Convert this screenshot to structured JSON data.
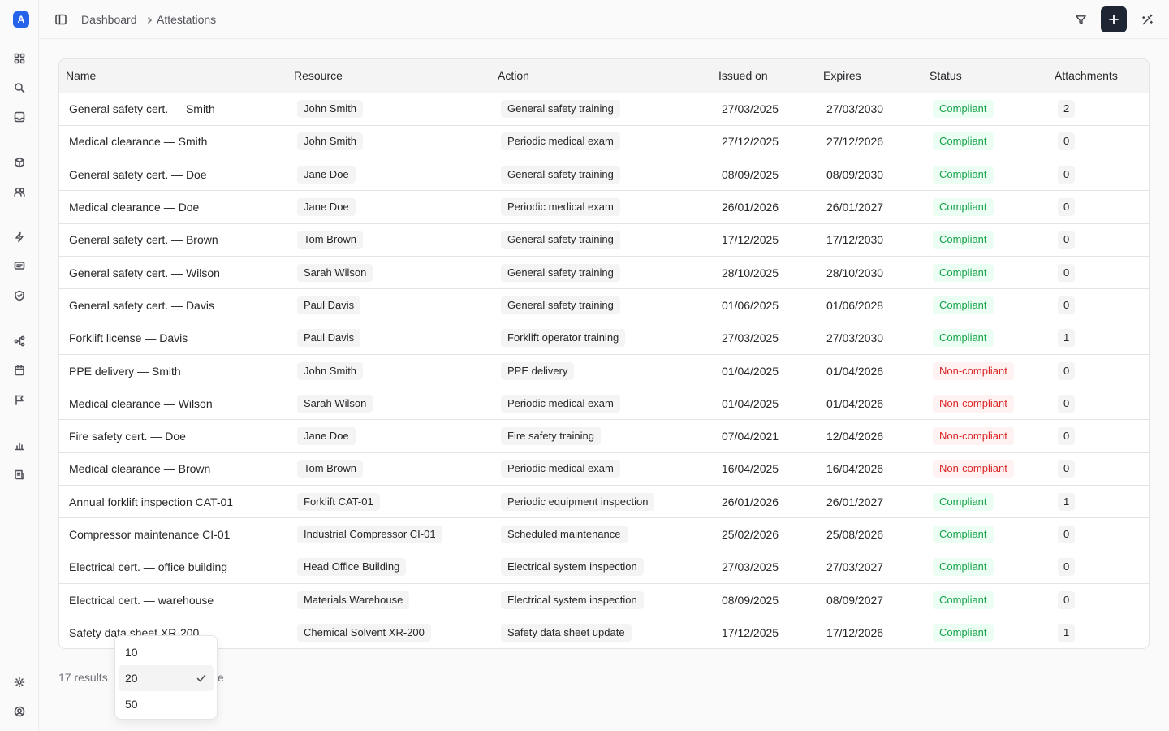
{
  "app": {
    "logo_letter": "A"
  },
  "sidebar": {
    "icons": [
      "grid-icon",
      "search-icon",
      "inbox-icon",
      "box-icon",
      "users-icon",
      "bolt-icon",
      "chat-icon",
      "shield-icon",
      "workflow-icon",
      "calendar-icon",
      "flag-icon",
      "chart-icon",
      "report-icon",
      "settings-icon",
      "account-icon"
    ]
  },
  "breadcrumb": {
    "home": "Dashboard",
    "current": "Attestations"
  },
  "table": {
    "columns": [
      "Name",
      "Resource",
      "Action",
      "Issued on",
      "Expires",
      "Status",
      "Attachments"
    ],
    "rows": [
      {
        "name": "General safety cert. — Smith",
        "resource": "John Smith",
        "action": "General safety training",
        "issued": "27/03/2025",
        "expires": "27/03/2030",
        "status": "Compliant",
        "attachments": "2"
      },
      {
        "name": "Medical clearance — Smith",
        "resource": "John Smith",
        "action": "Periodic medical exam",
        "issued": "27/12/2025",
        "expires": "27/12/2026",
        "status": "Compliant",
        "attachments": "0"
      },
      {
        "name": "General safety cert. — Doe",
        "resource": "Jane Doe",
        "action": "General safety training",
        "issued": "08/09/2025",
        "expires": "08/09/2030",
        "status": "Compliant",
        "attachments": "0"
      },
      {
        "name": "Medical clearance — Doe",
        "resource": "Jane Doe",
        "action": "Periodic medical exam",
        "issued": "26/01/2026",
        "expires": "26/01/2027",
        "status": "Compliant",
        "attachments": "0"
      },
      {
        "name": "General safety cert. — Brown",
        "resource": "Tom Brown",
        "action": "General safety training",
        "issued": "17/12/2025",
        "expires": "17/12/2030",
        "status": "Compliant",
        "attachments": "0"
      },
      {
        "name": "General safety cert. — Wilson",
        "resource": "Sarah Wilson",
        "action": "General safety training",
        "issued": "28/10/2025",
        "expires": "28/10/2030",
        "status": "Compliant",
        "attachments": "0"
      },
      {
        "name": "General safety cert. — Davis",
        "resource": "Paul Davis",
        "action": "General safety training",
        "issued": "01/06/2025",
        "expires": "01/06/2028",
        "status": "Compliant",
        "attachments": "0"
      },
      {
        "name": "Forklift license — Davis",
        "resource": "Paul Davis",
        "action": "Forklift operator training",
        "issued": "27/03/2025",
        "expires": "27/03/2030",
        "status": "Compliant",
        "attachments": "1"
      },
      {
        "name": "PPE delivery — Smith",
        "resource": "John Smith",
        "action": "PPE delivery",
        "issued": "01/04/2025",
        "expires": "01/04/2026",
        "status": "Non-compliant",
        "attachments": "0"
      },
      {
        "name": "Medical clearance — Wilson",
        "resource": "Sarah Wilson",
        "action": "Periodic medical exam",
        "issued": "01/04/2025",
        "expires": "01/04/2026",
        "status": "Non-compliant",
        "attachments": "0"
      },
      {
        "name": "Fire safety cert. — Doe",
        "resource": "Jane Doe",
        "action": "Fire safety training",
        "issued": "07/04/2021",
        "expires": "12/04/2026",
        "status": "Non-compliant",
        "attachments": "0"
      },
      {
        "name": "Medical clearance — Brown",
        "resource": "Tom Brown",
        "action": "Periodic medical exam",
        "issued": "16/04/2025",
        "expires": "16/04/2026",
        "status": "Non-compliant",
        "attachments": "0"
      },
      {
        "name": "Annual forklift inspection CAT-01",
        "resource": "Forklift CAT-01",
        "action": "Periodic equipment inspection",
        "issued": "26/01/2026",
        "expires": "26/01/2027",
        "status": "Compliant",
        "attachments": "1"
      },
      {
        "name": "Compressor maintenance CI-01",
        "resource": "Industrial Compressor CI-01",
        "action": "Scheduled maintenance",
        "issued": "25/02/2026",
        "expires": "25/08/2026",
        "status": "Compliant",
        "attachments": "0"
      },
      {
        "name": "Electrical cert. — office building",
        "resource": "Head Office Building",
        "action": "Electrical system inspection",
        "issued": "27/03/2025",
        "expires": "27/03/2027",
        "status": "Compliant",
        "attachments": "0"
      },
      {
        "name": "Electrical cert. — warehouse",
        "resource": "Materials Warehouse",
        "action": "Electrical system inspection",
        "issued": "08/09/2025",
        "expires": "08/09/2027",
        "status": "Compliant",
        "attachments": "0"
      },
      {
        "name": "Safety data sheet XR-200",
        "resource": "Chemical Solvent XR-200",
        "action": "Safety data sheet update",
        "issued": "17/12/2025",
        "expires": "17/12/2026",
        "status": "Compliant",
        "attachments": "1"
      }
    ]
  },
  "footer": {
    "results": "17 results",
    "trigger_tail": "e"
  },
  "page_size_dropdown": {
    "options": [
      "10",
      "20",
      "50"
    ],
    "selected": "20"
  },
  "colors": {
    "accent": "#2563eb",
    "primary_button": "#1e2533",
    "compliant": "#16a34a",
    "non_compliant": "#dc2626"
  }
}
